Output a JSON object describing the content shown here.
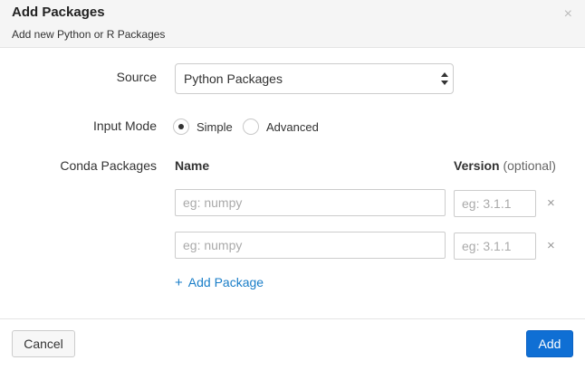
{
  "dialog": {
    "title": "Add Packages",
    "subtitle": "Add new Python or R Packages",
    "close_label": "×"
  },
  "source": {
    "label": "Source",
    "selected": "Python Packages"
  },
  "input_mode": {
    "label": "Input Mode",
    "options": [
      {
        "label": "Simple",
        "selected": true
      },
      {
        "label": "Advanced",
        "selected": false
      }
    ]
  },
  "conda": {
    "label": "Conda Packages",
    "name_header": "Name",
    "version_header": "Version",
    "version_optional": "(optional)",
    "rows": [
      {
        "name_placeholder": "eg: numpy",
        "version_placeholder": "eg: 3.1.1",
        "remove_label": "×"
      },
      {
        "name_placeholder": "eg: numpy",
        "version_placeholder": "eg: 3.1.1",
        "remove_label": "×"
      }
    ],
    "add_package_label": "Add Package",
    "add_package_plus": "+"
  },
  "footer": {
    "cancel_label": "Cancel",
    "add_label": "Add"
  },
  "colors": {
    "primary": "#0f6fd4",
    "link": "#1a7ec8"
  }
}
